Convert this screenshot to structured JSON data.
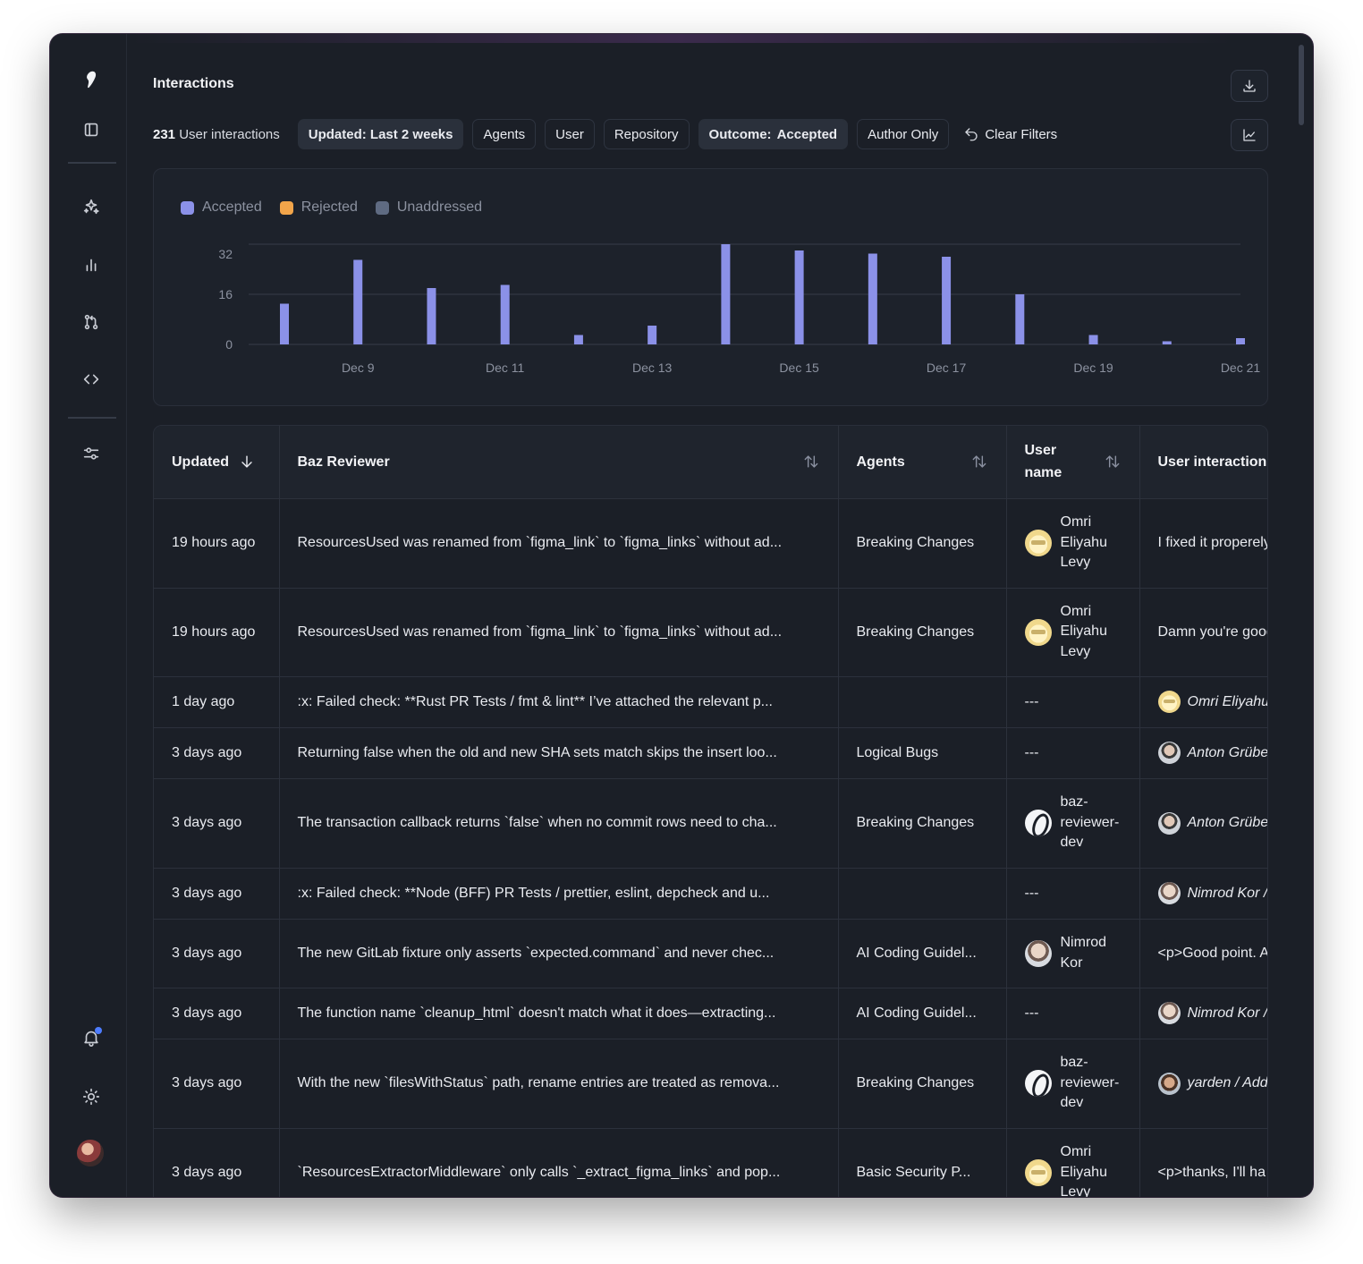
{
  "sidebar": {
    "icons": [
      "logo-icon",
      "panel-toggle-icon",
      "sparkles-icon",
      "bar-chart-icon",
      "pull-request-icon",
      "code-icon",
      "settings-sliders-icon",
      "bell-icon",
      "sun-icon"
    ]
  },
  "header": {
    "title": "Interactions"
  },
  "filters": {
    "count": "231",
    "count_suffix": "User interactions",
    "updated": "Updated: Last 2 weeks",
    "agents": "Agents",
    "user": "User",
    "repository": "Repository",
    "outcome_key": "Outcome:",
    "outcome_value": "Accepted",
    "author_only": "Author Only",
    "clear": "Clear Filters"
  },
  "chart_data": {
    "type": "bar",
    "legend": [
      {
        "name": "Accepted",
        "color": "#8b91e8"
      },
      {
        "name": "Rejected",
        "color": "#f2a54a"
      },
      {
        "name": "Unaddressed",
        "color": "#5f6b82"
      }
    ],
    "yticks": [
      "0",
      "16",
      "32"
    ],
    "ylim": [
      0,
      32
    ],
    "xtick_labels": [
      "Dec 9",
      "Dec 11",
      "Dec 13",
      "Dec 15",
      "Dec 17",
      "Dec 19",
      "Dec 21"
    ],
    "series": [
      {
        "name": "Accepted",
        "color": "#8b91e8",
        "categories": [
          "Dec 8",
          "Dec 9",
          "Dec 10",
          "Dec 11",
          "Dec 12",
          "Dec 13",
          "Dec 14",
          "Dec 15",
          "Dec 16",
          "Dec 17",
          "Dec 18",
          "Dec 19",
          "Dec 20",
          "Dec 21"
        ],
        "values": [
          13,
          27,
          18,
          19,
          3,
          6,
          32,
          30,
          29,
          28,
          16,
          3,
          1,
          2
        ]
      }
    ]
  },
  "table": {
    "columns": [
      {
        "label": "Updated"
      },
      {
        "label": "Baz Reviewer"
      },
      {
        "label": "Agents"
      },
      {
        "label": "User name"
      },
      {
        "label": "User interaction"
      }
    ],
    "rows": [
      {
        "updated": "19 hours ago",
        "reviewer": "ResourcesUsed was renamed from `figma_link` to `figma_links` without ad...",
        "agent": "Breaking Changes",
        "user": "Omri Eliyahu Levy",
        "user_av": "omri",
        "interaction": "I fixed it properely",
        "inter_type": "text"
      },
      {
        "updated": "19 hours ago",
        "reviewer": "ResourcesUsed was renamed from `figma_link` to `figma_links` without ad...",
        "agent": "Breaking Changes",
        "user": "Omri Eliyahu Levy",
        "user_av": "omri",
        "interaction": "Damn you're good",
        "inter_type": "text"
      },
      {
        "updated": "1 day ago",
        "reviewer": ":x: Failed check: **Rust PR Tests / fmt & lint** I’ve attached the relevant p...",
        "agent": "",
        "user": "---",
        "user_av": "",
        "interaction": "Omri Eliyahu",
        "inter_type": "user",
        "inter_av": "omri"
      },
      {
        "updated": "3 days ago",
        "reviewer": "Returning false when the old and new SHA sets match skips the insert loo...",
        "agent": "Logical Bugs",
        "user": "---",
        "user_av": "",
        "interaction": "Anton Grübel",
        "inter_type": "user",
        "inter_av": "anton"
      },
      {
        "updated": "3 days ago",
        "reviewer": "The transaction callback returns `false` when no commit rows need to cha...",
        "agent": "Breaking Changes",
        "user": "baz-reviewer-dev",
        "user_av": "baz",
        "interaction": "Anton Grübel",
        "inter_type": "user",
        "inter_av": "anton"
      },
      {
        "updated": "3 days ago",
        "reviewer": ":x: Failed check: **Node (BFF) PR Tests / prettier, eslint, depcheck and u...",
        "agent": "",
        "user": "---",
        "user_av": "",
        "interaction": "Nimrod Kor / ",
        "inter_type": "user",
        "inter_av": "nimrod"
      },
      {
        "updated": "3 days ago",
        "reviewer": "The new GitLab fixture only asserts `expected.command` and never chec...",
        "agent": "AI Coding Guidel...",
        "user": "Nimrod Kor",
        "user_av": "nimrod",
        "interaction": "<p>Good point. A",
        "inter_type": "text"
      },
      {
        "updated": "3 days ago",
        "reviewer": "The function name `cleanup_html` doesn't match what it does—extracting...",
        "agent": "AI Coding Guidel...",
        "user": "---",
        "user_av": "",
        "interaction": "Nimrod Kor / ",
        "inter_type": "user",
        "inter_av": "nimrod"
      },
      {
        "updated": "3 days ago",
        "reviewer": "With the new `filesWithStatus` path, rename entries are treated as remova...",
        "agent": "Breaking Changes",
        "user": "baz-reviewer-dev",
        "user_av": "baz",
        "interaction": "yarden / Add",
        "inter_type": "user",
        "inter_av": "yarden"
      },
      {
        "updated": "3 days ago",
        "reviewer": "`ResourcesExtractorMiddleware` only calls `_extract_figma_links` and pop...",
        "agent": "Basic Security P...",
        "user": "Omri Eliyahu Levy",
        "user_av": "omri",
        "interaction": "<p>thanks, I'll ha",
        "inter_type": "text"
      }
    ]
  }
}
